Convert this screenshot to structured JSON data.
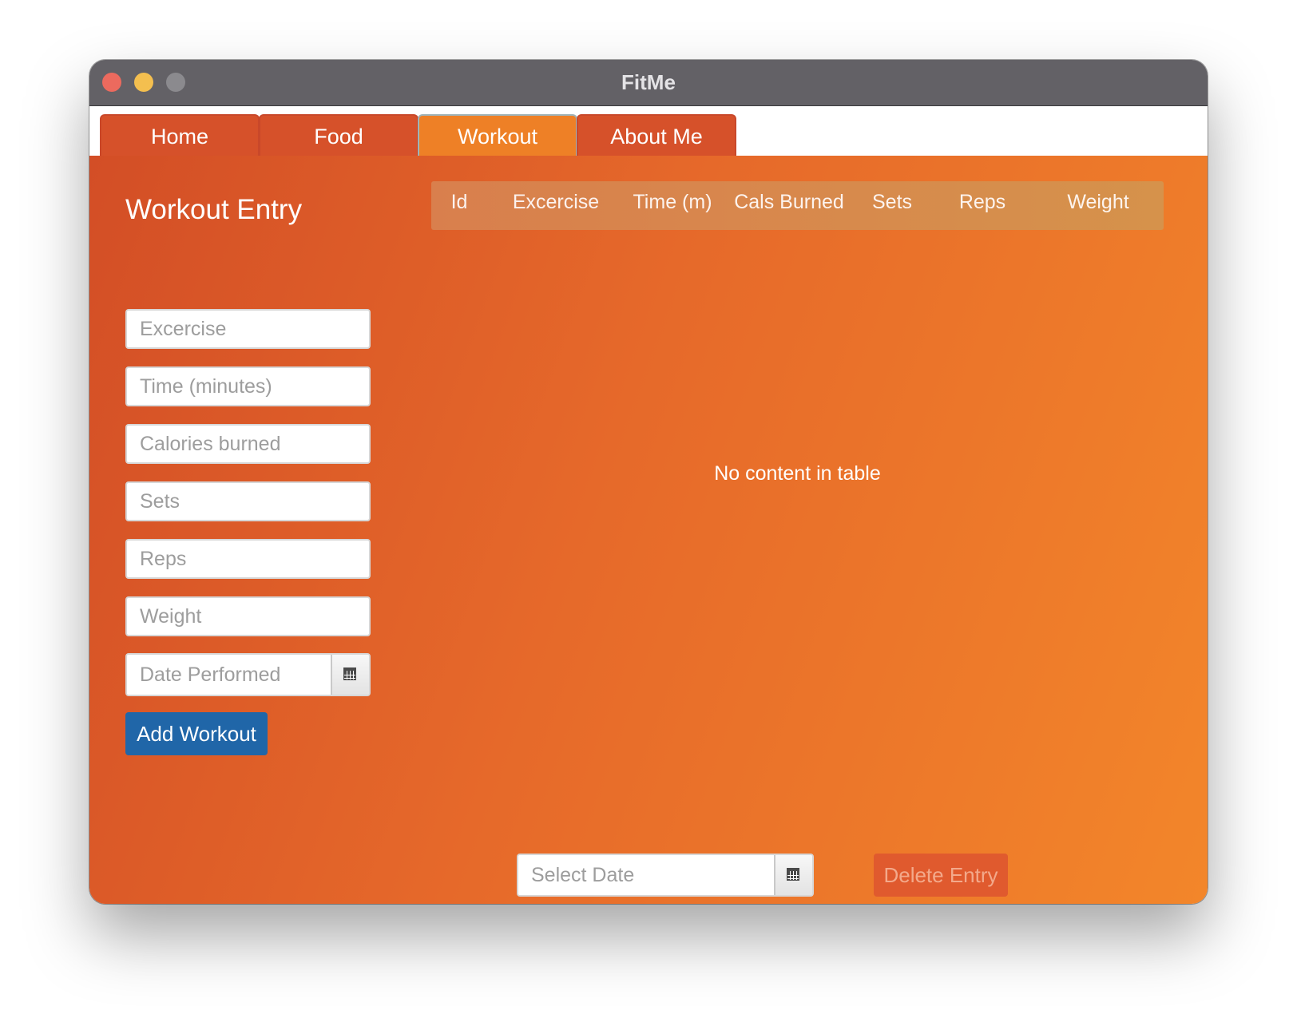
{
  "window": {
    "title": "FitMe"
  },
  "tabs": [
    {
      "label": "Home",
      "active": false
    },
    {
      "label": "Food",
      "active": false
    },
    {
      "label": "Workout",
      "active": true
    },
    {
      "label": "About Me",
      "active": false
    }
  ],
  "form": {
    "title": "Workout Entry",
    "fields": [
      {
        "placeholder": "Excercise",
        "value": ""
      },
      {
        "placeholder": "Time (minutes)",
        "value": ""
      },
      {
        "placeholder": "Calories burned",
        "value": ""
      },
      {
        "placeholder": "Sets",
        "value": ""
      },
      {
        "placeholder": "Reps",
        "value": ""
      },
      {
        "placeholder": "Weight",
        "value": ""
      }
    ],
    "date_placeholder": "Date Performed",
    "add_button": "Add Workout"
  },
  "table": {
    "columns": [
      "Id",
      "Excercise",
      "Time (m)",
      "Cals Burned",
      "Sets",
      "Reps",
      "Weight"
    ],
    "rows": [],
    "empty_text": "No content in table"
  },
  "bottom": {
    "select_date_placeholder": "Select Date",
    "delete_button": "Delete Entry"
  },
  "colors": {
    "tab_active": "#ee8026",
    "tab_inactive": "#d6512a",
    "add_button": "#2066a8",
    "delete_button": "#e05a2e",
    "titlebar": "#636166"
  },
  "icons": [
    "calendar-icon"
  ]
}
